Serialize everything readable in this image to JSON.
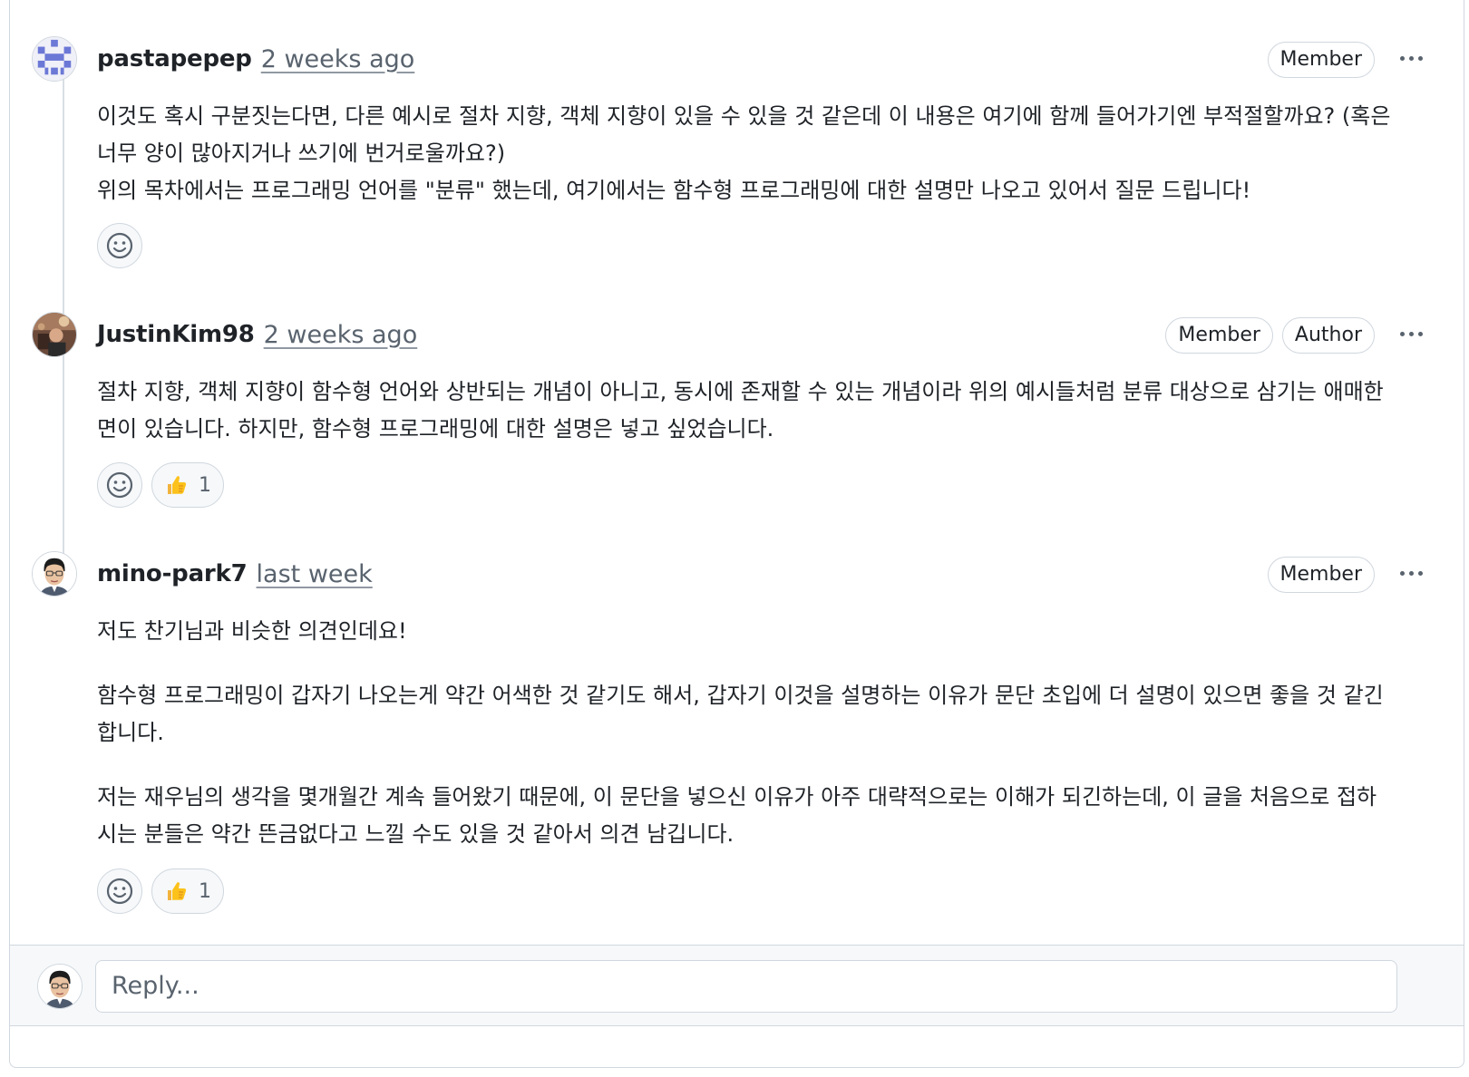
{
  "comments": [
    {
      "author": "pastapepep",
      "time": "2 weeks ago",
      "labels": [
        "Member"
      ],
      "paragraphs": [
        "이것도 혹시 구분짓는다면, 다른 예시로 절차 지향, 객체 지향이 있을 수 있을 것 같은데 이 내용은 여기에 함께 들어가기엔 부적절할까요? (혹은 너무 양이 많아지거나 쓰기에 번거로울까요?)",
        "위의 목차에서는 프로그래밍 언어를 \"분류\" 했는데, 여기에서는 함수형 프로그래밍에 대한 설명만 나오고 있어서 질문 드립니다!"
      ],
      "reactions": []
    },
    {
      "author": "JustinKim98",
      "time": "2 weeks ago",
      "labels": [
        "Member",
        "Author"
      ],
      "paragraphs": [
        "절차 지향, 객체 지향이 함수형 언어와 상반되는 개념이 아니고, 동시에 존재할 수 있는 개념이라 위의 예시들처럼 분류 대상으로 삼기는 애매한 면이 있습니다. 하지만, 함수형 프로그래밍에 대한 설명은 넣고 싶었습니다."
      ],
      "reactions": [
        {
          "icon": "thumbs-up",
          "count": "1"
        }
      ]
    },
    {
      "author": "mino-park7",
      "time": "last week",
      "labels": [
        "Member"
      ],
      "paragraphs": [
        "저도 찬기님과 비슷한 의견인데요!",
        "함수형 프로그래밍이 갑자기 나오는게 약간 어색한 것 같기도 해서, 갑자기 이것을 설명하는 이유가 문단 초입에 더 설명이 있으면 좋을 것 같긴 합니다.",
        "저는 재우님의 생각을 몇개월간 계속 들어왔기 때문에, 이 문단을 넣으신 이유가 아주 대략적으로는 이해가 되긴하는데, 이 글을 처음으로 접하시는 분들은 약간 뜬금없다고 느낄 수도 있을 것 같아서 의견 남깁니다."
      ],
      "reactions": [
        {
          "icon": "thumbs-up",
          "count": "1"
        }
      ]
    }
  ],
  "reply": {
    "placeholder": "Reply..."
  }
}
